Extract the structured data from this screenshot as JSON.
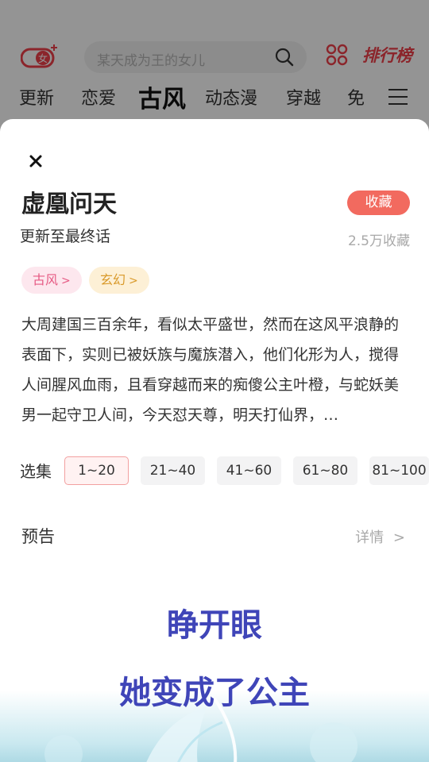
{
  "background_app": {
    "search_placeholder": "某天成为王的女儿",
    "ranking_label": "排行榜",
    "categories": [
      "更新",
      "恋爱",
      "古风",
      "动态漫",
      "穿越",
      "免"
    ]
  },
  "detail_sheet": {
    "title": "虚凰问天",
    "update_status": "更新至最终话",
    "favorite_label": "收藏",
    "favorite_count": "2.5万收藏",
    "tags": [
      {
        "label": "古风"
      },
      {
        "label": "玄幻"
      }
    ],
    "description": "大周建国三百余年，看似太平盛世，然而在这风平浪静的表面下，实则已被妖族与魔族潜入，他们化形为人，搅得人间腥风血雨，且看穿越而来的痴傻公主叶橙，与蛇妖美男一起守卫人间，今天怼天尊，明天打仙界，…",
    "episodes_label": "选集",
    "episodes": [
      "1~20",
      "21~40",
      "41~60",
      "61~80",
      "81~100"
    ],
    "preview_label": "预告",
    "detail_label": "详情",
    "trailer_captions": [
      "睁开眼",
      "她变成了公主"
    ]
  },
  "colors": {
    "accent": "#f26a5f",
    "brand_red": "#f0404a",
    "caption_blue": "#3f45b8"
  }
}
